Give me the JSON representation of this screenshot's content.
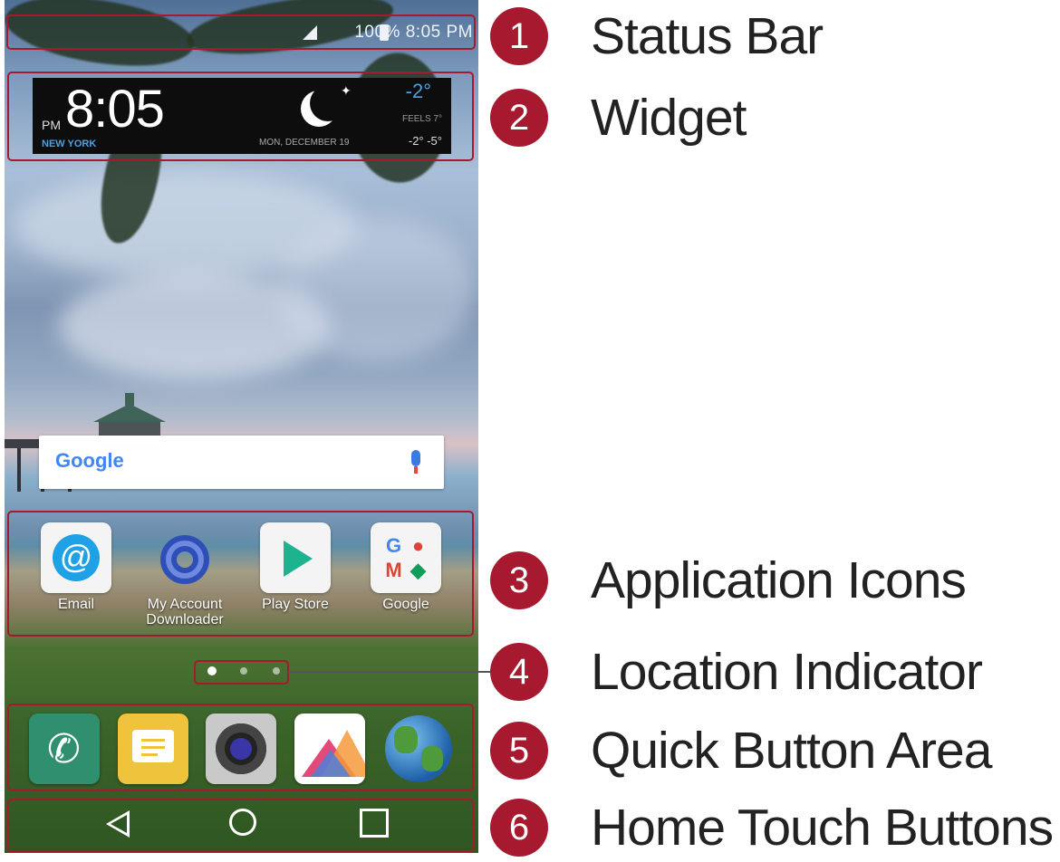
{
  "status_bar": {
    "text": "100% 8:05 PM"
  },
  "widget": {
    "ampm": "PM",
    "time": "8:05",
    "city": "NEW YORK",
    "temp": "-2°",
    "feels": "FEELS 7°",
    "date": "MON, DECEMBER 19",
    "range": "-2° -5°"
  },
  "search": {
    "brand": "Google"
  },
  "apps": [
    {
      "label": "Email"
    },
    {
      "label_line1": "My Account",
      "label_line2": "Downloader"
    },
    {
      "label": "Play Store"
    },
    {
      "label": "Google"
    }
  ],
  "legend": [
    {
      "number": "1",
      "label": "Status Bar"
    },
    {
      "number": "2",
      "label": "Widget"
    },
    {
      "number": "3",
      "label": "Application Icons"
    },
    {
      "number": "4",
      "label": "Location Indicator"
    },
    {
      "number": "5",
      "label": "Quick Button Area"
    },
    {
      "number": "6",
      "label": "Home Touch Buttons"
    }
  ],
  "colors": {
    "callout": "#a6192e",
    "accent_blue": "#4aa3e0"
  },
  "icons": {
    "quick_buttons": [
      "phone-icon",
      "messaging-icon",
      "camera-icon",
      "gallery-icon",
      "browser-globe-icon"
    ],
    "nav": [
      "back-icon",
      "home-icon",
      "recent-apps-icon"
    ]
  }
}
